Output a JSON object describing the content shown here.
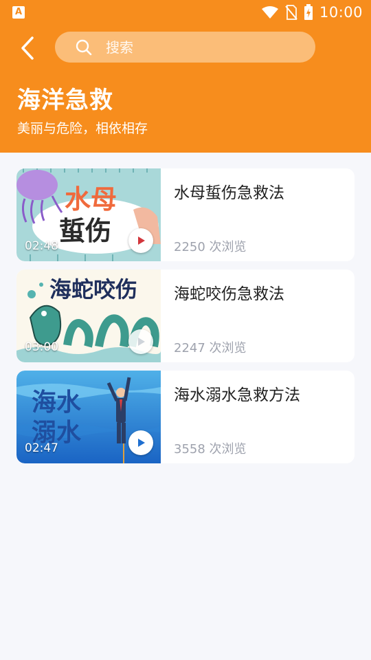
{
  "status_bar": {
    "time": "10:00"
  },
  "header": {
    "search_placeholder": "搜索",
    "title": "海洋急救",
    "subtitle": "美丽与危险，相依相存"
  },
  "videos": [
    {
      "thumb_text": [
        "水母",
        "蜇伤"
      ],
      "duration": "02:48",
      "title": "水母蜇伤急救法",
      "views": "2250 次浏览"
    },
    {
      "thumb_text": [
        "海蛇咬伤"
      ],
      "duration": "03:00",
      "title": "海蛇咬伤急救法",
      "views": "2247 次浏览"
    },
    {
      "thumb_text": [
        "海水",
        "溺水"
      ],
      "duration": "02:47",
      "title": "海水溺水急救方法",
      "views": "3558 次浏览"
    }
  ],
  "colors": {
    "header_bg": "#f78d1d",
    "search_bg": "#fbbd78",
    "page_bg": "#f6f7fb"
  }
}
